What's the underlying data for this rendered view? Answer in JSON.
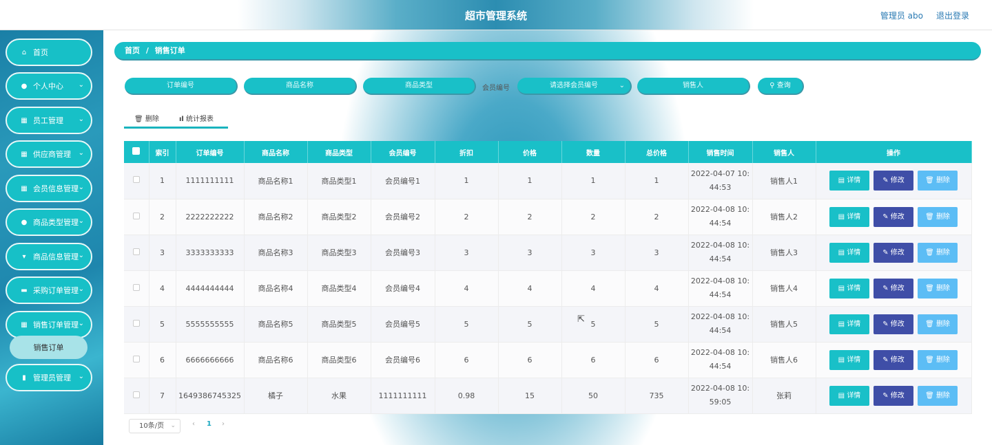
{
  "header": {
    "title": "超市管理系统",
    "user": "管理员 abo",
    "logout": "退出登录"
  },
  "sidebar": {
    "items": [
      {
        "label": "首页",
        "icon": "home-icon",
        "glyph": "⌂",
        "chev": ""
      },
      {
        "label": "个人中心",
        "icon": "user-icon",
        "glyph": "●",
        "chev": "⌄"
      },
      {
        "label": "员工管理",
        "icon": "grid-icon",
        "glyph": "▦",
        "chev": "⌄"
      },
      {
        "label": "供应商管理",
        "icon": "grid-icon",
        "glyph": "▦",
        "chev": "⌄"
      },
      {
        "label": "会员信息管理",
        "icon": "grid-icon",
        "glyph": "▦",
        "chev": "⌄"
      },
      {
        "label": "商品类型管理",
        "icon": "user-icon",
        "glyph": "●",
        "chev": "⌄"
      },
      {
        "label": "商品信息管理",
        "icon": "monitor-icon",
        "glyph": "▾",
        "chev": "⌄"
      },
      {
        "label": "采购订单管理",
        "icon": "monitor-icon",
        "glyph": "▬",
        "chev": "⌄"
      },
      {
        "label": "销售订单管理",
        "icon": "grid-icon",
        "glyph": "▦",
        "chev": "⌄"
      },
      {
        "label": "管理员管理",
        "icon": "chart-icon",
        "glyph": "▮",
        "chev": "⌄"
      }
    ],
    "submenu": "销售订单"
  },
  "breadcrumb": {
    "home": "首页",
    "sep": "/",
    "current": "销售订单"
  },
  "search": {
    "order_no": "订单编号",
    "product_name": "商品名称",
    "product_type": "商品类型",
    "member_label": "会员编号",
    "member_select": "请选择会员编号",
    "seller": "销售人",
    "query": "查询",
    "query_icon": "search-icon"
  },
  "tabs": {
    "delete": "删除",
    "report": "统计报表"
  },
  "table": {
    "headers": [
      "索引",
      "订单编号",
      "商品名称",
      "商品类型",
      "会员编号",
      "折扣",
      "价格",
      "数量",
      "总价格",
      "销售时间",
      "销售人",
      "操作"
    ],
    "rows": [
      [
        "1",
        "1111111111",
        "商品名称1",
        "商品类型1",
        "会员编号1",
        "1",
        "1",
        "1",
        "1",
        "2022-04-07 10:",
        "44:53",
        "销售人1"
      ],
      [
        "2",
        "2222222222",
        "商品名称2",
        "商品类型2",
        "会员编号2",
        "2",
        "2",
        "2",
        "2",
        "2022-04-08 10:",
        "44:54",
        "销售人2"
      ],
      [
        "3",
        "3333333333",
        "商品名称3",
        "商品类型3",
        "会员编号3",
        "3",
        "3",
        "3",
        "3",
        "2022-04-08 10:",
        "44:54",
        "销售人3"
      ],
      [
        "4",
        "4444444444",
        "商品名称4",
        "商品类型4",
        "会员编号4",
        "4",
        "4",
        "4",
        "4",
        "2022-04-08 10:",
        "44:54",
        "销售人4"
      ],
      [
        "5",
        "5555555555",
        "商品名称5",
        "商品类型5",
        "会员编号5",
        "5",
        "5",
        "5",
        "5",
        "2022-04-08 10:",
        "44:54",
        "销售人5"
      ],
      [
        "6",
        "6666666666",
        "商品名称6",
        "商品类型6",
        "会员编号6",
        "6",
        "6",
        "6",
        "6",
        "2022-04-08 10:",
        "44:54",
        "销售人6"
      ],
      [
        "7",
        "1649386745325",
        "橘子",
        "水果",
        "1111111111",
        "0.98",
        "15",
        "50",
        "735",
        "2022-04-08 10:",
        "59:05",
        "张莉"
      ]
    ],
    "actions": {
      "detail": "详情",
      "edit": "修改",
      "delete": "删除"
    }
  },
  "pagination": {
    "page_size": "10条/页",
    "current": "1",
    "prev": "‹",
    "next": "›"
  },
  "colors": {
    "accent": "#19c0c8",
    "edit": "#3f4ea7",
    "delete": "#5cbdf5"
  }
}
